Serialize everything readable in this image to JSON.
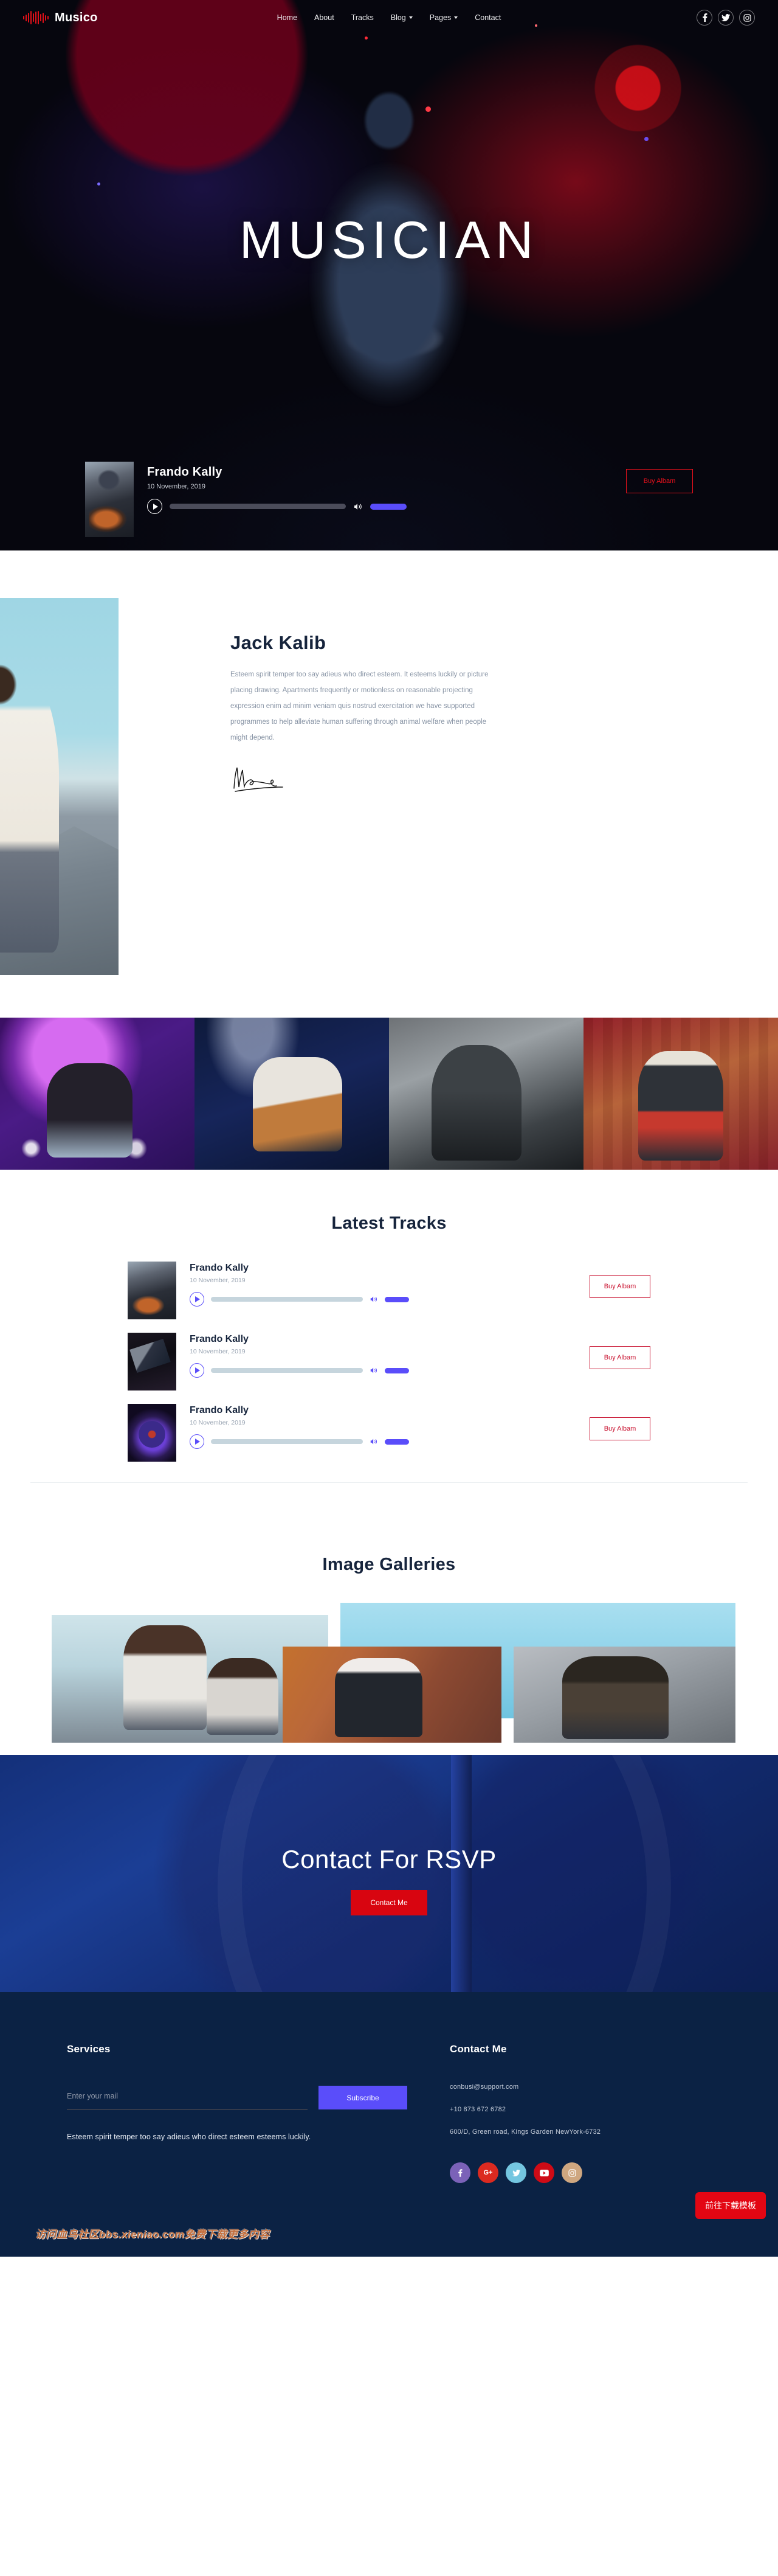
{
  "nav": {
    "brand": "Musico",
    "brand_icon": "sound-wave-icon",
    "items": [
      {
        "label": "Home",
        "caret": false
      },
      {
        "label": "About",
        "caret": false
      },
      {
        "label": "Tracks",
        "caret": false
      },
      {
        "label": "Blog",
        "caret": true
      },
      {
        "label": "Pages",
        "caret": true
      },
      {
        "label": "Contact",
        "caret": false
      }
    ],
    "social": [
      {
        "name": "facebook-icon",
        "glyph": "f"
      },
      {
        "name": "twitter-icon",
        "glyph": "🐦"
      },
      {
        "name": "instagram-icon",
        "glyph": "▣"
      }
    ]
  },
  "hero": {
    "title": "MUSICIAN",
    "player": {
      "track_title": "Frando Kally",
      "date": "10 November, 2019",
      "buy_label": "Buy Albam",
      "play_icon": "play-icon",
      "volume_icon": "volume-icon"
    }
  },
  "about": {
    "name": "Jack Kalib",
    "description": "Esteem spirit temper too say adieus who direct esteem. It esteems luckily or picture placing drawing. Apartments frequently or motionless on reasonable projecting expression enim ad minim veniam quis nostrud exercitation we have supported programmes to help alleviate human suffering through animal welfare when people might depend.",
    "signature_icon": "signature-icon"
  },
  "tracks": {
    "title": "Latest Tracks",
    "items": [
      {
        "name": "Frando Kally",
        "date": "10 November, 2019",
        "buy_label": "Buy Albam"
      },
      {
        "name": "Frando Kally",
        "date": "10 November, 2019",
        "buy_label": "Buy Albam"
      },
      {
        "name": "Frando Kally",
        "date": "10 November, 2019",
        "buy_label": "Buy Albam"
      }
    ]
  },
  "gallery": {
    "title": "Image Galleries"
  },
  "rsvp": {
    "title": "Contact For RSVP",
    "button": "Contact Me"
  },
  "footer": {
    "services_title": "Services",
    "contact_title": "Contact Me",
    "subscribe_placeholder": "Enter your mail",
    "subscribe_value": "",
    "subscribe_button": "Subscribe",
    "note": "Esteem spirit temper too say adieus who direct esteem esteems luckily.",
    "contact": {
      "email": "conbusi@support.com",
      "phone": "+10 873 672 6782",
      "address": "600/D, Green road, Kings Garden NewYork-6732"
    },
    "social": [
      {
        "name": "facebook-icon",
        "glyph": "f"
      },
      {
        "name": "google-plus-icon",
        "glyph": "G+"
      },
      {
        "name": "twitter-icon",
        "glyph": "🐦"
      },
      {
        "name": "youtube-icon",
        "glyph": "▶"
      },
      {
        "name": "instagram-icon",
        "glyph": "▣"
      }
    ],
    "watermark": "访问血鸟社区bbs.xieniao.com免费下载更多内容",
    "download_button": "前往下载模板"
  },
  "colors": {
    "accent_red": "#e8111c",
    "accent_purple": "#5a4dfa",
    "dark_navy": "#0b2244",
    "heading": "#16243c"
  }
}
